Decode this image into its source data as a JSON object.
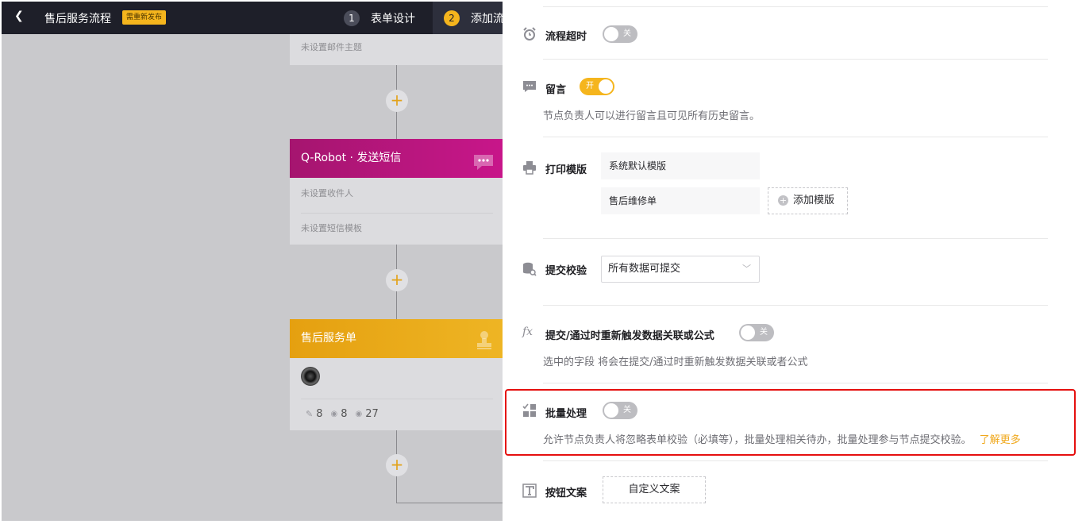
{
  "topbar": {
    "title": "售后服务流程",
    "badge": "需重新发布",
    "steps": [
      {
        "num": "1",
        "label": "表单设计"
      },
      {
        "num": "2",
        "label": "添加流"
      }
    ]
  },
  "flow": {
    "email_node": {
      "row": "未设置邮件主题"
    },
    "sms_node": {
      "title": "Q-Robot · 发送短信",
      "color": "#b8157e",
      "rows": [
        "未设置收件人",
        "未设置短信模板"
      ]
    },
    "form_node": {
      "title": "售后服务单",
      "color": "#e8a317",
      "stats": {
        "edit": "8",
        "view": "8",
        "view2": "27"
      }
    },
    "plus_symbol": "+"
  },
  "panel": {
    "timeout": {
      "label": "流程超时",
      "toggle": "关",
      "on": false
    },
    "comment": {
      "label": "留言",
      "toggle": "开",
      "on": true,
      "desc": "节点负责人可以进行留言且可见所有历史留言。"
    },
    "print": {
      "label": "打印模版",
      "templates": [
        "系统默认模版",
        "售后维修单"
      ],
      "add_label": "添加模版"
    },
    "validate": {
      "label": "提交校验",
      "value": "所有数据可提交"
    },
    "formula": {
      "label": "提交/通过时重新触发数据关联或公式",
      "toggle": "关",
      "on": false,
      "desc": "选中的字段 将会在提交/通过时重新触发数据关联或者公式"
    },
    "batch": {
      "label": "批量处理",
      "toggle": "关",
      "on": false,
      "desc": "允许节点负责人将忽略表单校验（必填等），批量处理相关待办，批量处理参与节点提交校验。",
      "link": "了解更多"
    },
    "button_text": {
      "label": "按钮文案",
      "button": "自定义文案"
    }
  },
  "colors": {
    "accent": "#f5b51d",
    "highlight": "#e5100f",
    "topbar": "#1e1f29"
  }
}
